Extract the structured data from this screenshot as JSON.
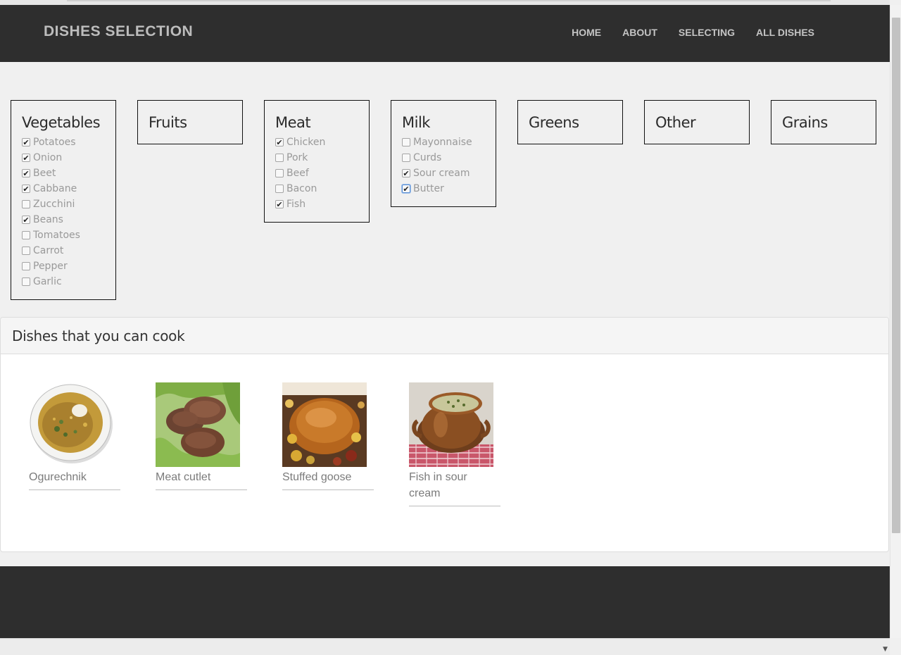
{
  "navbar": {
    "brand": "DISHES SELECTION",
    "links": [
      "HOME",
      "ABOUT",
      "SELECTING",
      "ALL DISHES"
    ]
  },
  "categories": [
    {
      "title": "Vegetables",
      "items": [
        {
          "label": "Potatoes",
          "checked": true
        },
        {
          "label": "Onion",
          "checked": true
        },
        {
          "label": "Beet",
          "checked": true
        },
        {
          "label": "Cabbane",
          "checked": true
        },
        {
          "label": "Zucchini",
          "checked": false
        },
        {
          "label": "Beans",
          "checked": true
        },
        {
          "label": "Tomatoes",
          "checked": false
        },
        {
          "label": "Carrot",
          "checked": false
        },
        {
          "label": "Pepper",
          "checked": false
        },
        {
          "label": "Garlic",
          "checked": false
        }
      ]
    },
    {
      "title": "Fruits",
      "items": []
    },
    {
      "title": "Meat",
      "items": [
        {
          "label": "Chicken",
          "checked": true
        },
        {
          "label": "Pork",
          "checked": false
        },
        {
          "label": "Beef",
          "checked": false
        },
        {
          "label": "Bacon",
          "checked": false
        },
        {
          "label": "Fish",
          "checked": true
        }
      ]
    },
    {
      "title": "Milk",
      "items": [
        {
          "label": "Mayonnaise",
          "checked": false
        },
        {
          "label": "Curds",
          "checked": false
        },
        {
          "label": "Sour cream",
          "checked": true
        },
        {
          "label": "Butter",
          "checked": true
        }
      ]
    },
    {
      "title": "Greens",
      "items": []
    },
    {
      "title": "Other",
      "items": []
    },
    {
      "title": "Grains",
      "items": []
    }
  ],
  "dishes_panel": {
    "title": "Dishes that you can cook",
    "dishes": [
      {
        "name": "Ogurechnik",
        "image": "soup-bowl"
      },
      {
        "name": "Meat cutlet",
        "image": "cutlets-on-lettuce"
      },
      {
        "name": "Stuffed goose",
        "image": "roast-goose"
      },
      {
        "name": "Fish in sour cream",
        "image": "clay-pot"
      }
    ]
  },
  "colors": {
    "navbar_bg": "#2e2e2e",
    "page_bg": "#f0f0f0",
    "brand_text": "#bdbdbd",
    "dish_name": "#7b7b7b"
  }
}
